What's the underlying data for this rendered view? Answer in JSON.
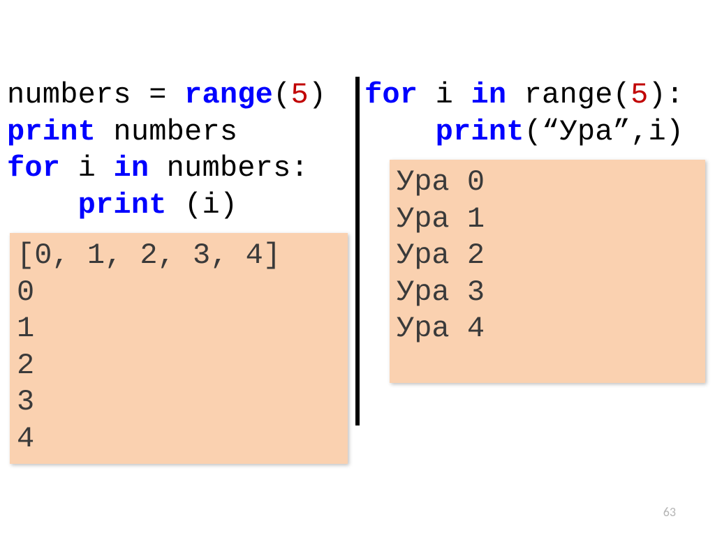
{
  "left": {
    "code": {
      "line1": {
        "t1": "numbers = ",
        "kw": "range",
        "paren_open": "(",
        "num": "5",
        "paren_close": ")"
      },
      "line2": {
        "kw": "print",
        "rest": " numbers"
      },
      "line3": {
        "kw1": "for",
        "mid": " i ",
        "kw2": "in",
        "rest": " numbers:"
      },
      "line4": {
        "indent": "    ",
        "kw": "print",
        "rest": " (i)"
      }
    },
    "output": "[0, 1, 2, 3, 4]\n0\n1\n2\n3\n4"
  },
  "right": {
    "code": {
      "line1": {
        "kw1": "for",
        "mid": " i ",
        "kw2": "in",
        "t2": " range(",
        "num": "5",
        "t3": "):"
      },
      "line2": {
        "indent": "    ",
        "kw": "print",
        "rest": "(“Ура”,i)"
      }
    },
    "output": "Ура 0\nУра 1\nУра 2\nУра 3\nУра 4"
  },
  "slide_number": "63"
}
